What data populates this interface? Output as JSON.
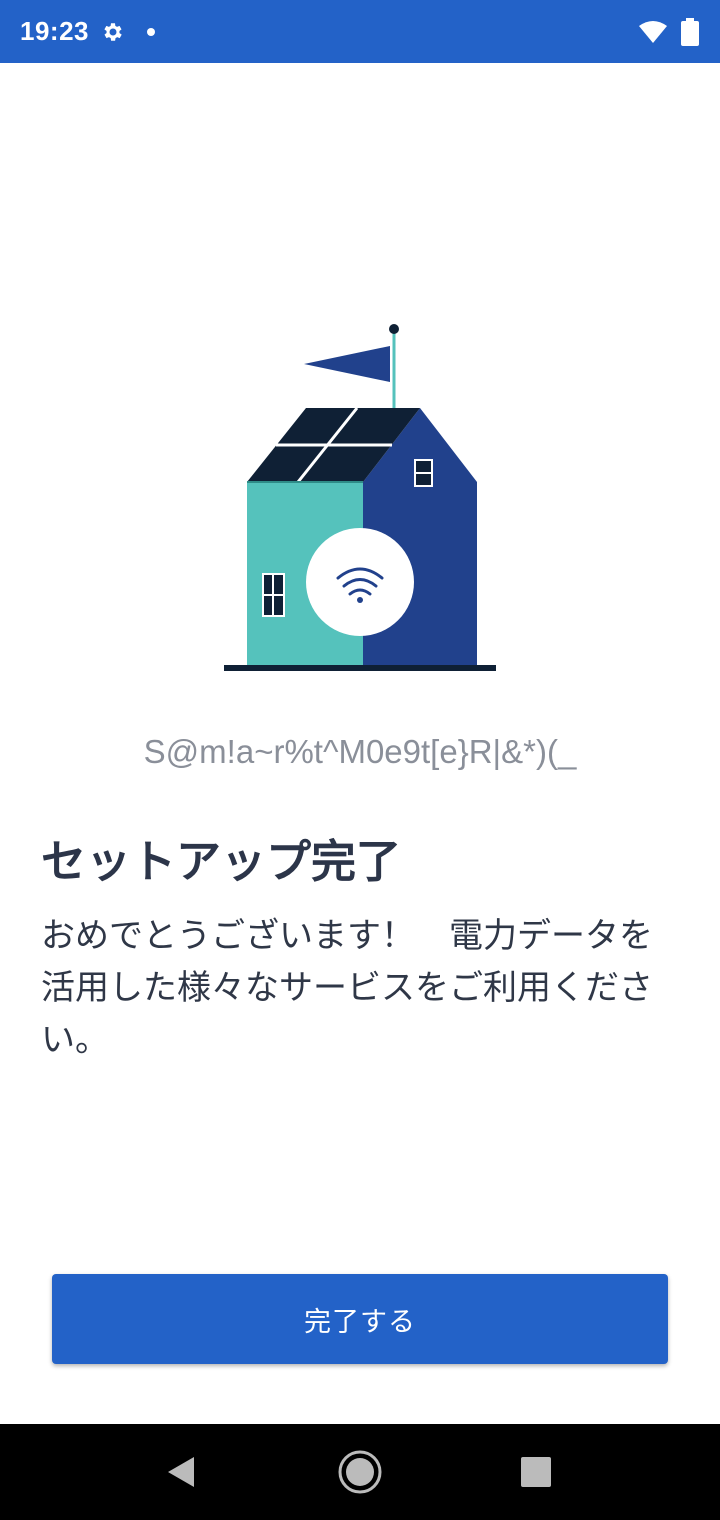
{
  "status_bar": {
    "time": "19:23",
    "icons": [
      "gear-icon",
      "notification-dot-icon",
      "wifi-icon",
      "battery-icon"
    ],
    "background": "#2362c8"
  },
  "illustration": {
    "name": "house-with-wifi-illustration",
    "colors": {
      "teal": "#55c2bc",
      "navy": "#21418c",
      "dark": "#0f2035",
      "white": "#ffffff"
    }
  },
  "device_name": "S@m!a~r%t^M0e9t[e}R|&*)(_",
  "title": "セットアップ完了",
  "message": "おめでとうございます！　電力データを活用した様々なサービスをご利用ください。",
  "done_button": {
    "label": "完了する",
    "color": "#2362c8"
  },
  "nav_bar": {
    "items": [
      "back-icon",
      "home-icon",
      "recents-icon"
    ]
  }
}
